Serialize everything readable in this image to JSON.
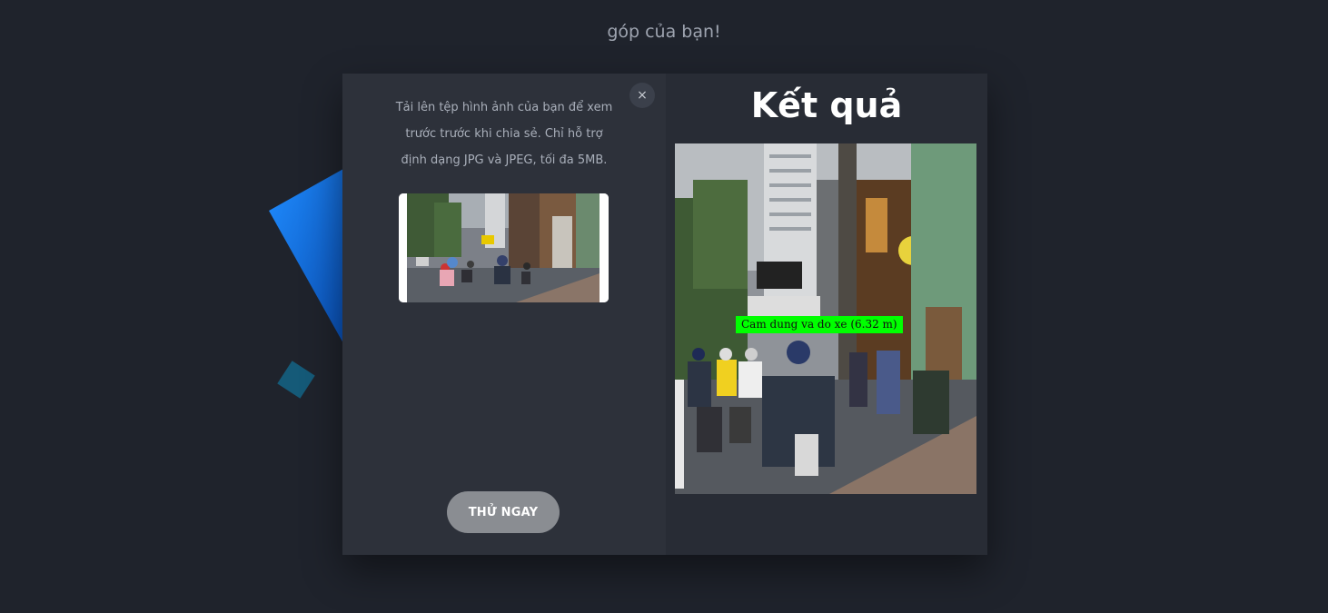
{
  "intro": {
    "text": "góp của bạn!"
  },
  "upload_panel": {
    "description": "Tải lên tệp hình ảnh của bạn để xem trước trước khi chia sẻ. Chỉ hỗ trợ định dạng JPG và JPEG, tối đa 5MB.",
    "close_label": "×",
    "try_button_label": "THỬ NGAY"
  },
  "result_panel": {
    "title": "Kết quả",
    "detection_label": "Cam dung va do xe (6.32 m)"
  },
  "colors": {
    "background": "#1f232c",
    "panel_left": "#2d313a",
    "panel_right": "#282c35",
    "detection_box": "#00ff00",
    "accent_blue": "#1a74e6"
  },
  "icons": {
    "close": "close-icon"
  }
}
